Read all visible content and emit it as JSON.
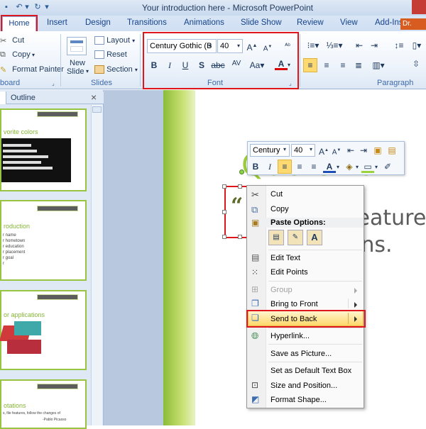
{
  "window": {
    "title": "Your introduction here - Microsoft PowerPoint",
    "user_tab": "Dr."
  },
  "tabs": [
    "Home",
    "Insert",
    "Design",
    "Transitions",
    "Animations",
    "Slide Show",
    "Review",
    "View",
    "Add-Ins"
  ],
  "clipboard": {
    "cut": "Cut",
    "copy": "Copy",
    "format_painter": "Format Painter",
    "label": "board"
  },
  "slides_group": {
    "new_slide_1": "New",
    "new_slide_2": "Slide",
    "layout": "Layout",
    "reset": "Reset",
    "section": "Section",
    "label": "Slides"
  },
  "font_group": {
    "font_name": "Century Gothic (B",
    "font_size": "40",
    "label": "Font"
  },
  "paragraph_group": {
    "label": "Paragraph"
  },
  "pane": {
    "tab_outline": "Outline",
    "close": "×"
  },
  "thumbnails": [
    {
      "title": "vorite colors"
    },
    {
      "title": "roduction",
      "lines": [
        "r name",
        "r hometown",
        "r education",
        "r placement",
        "r goal",
        "r"
      ]
    },
    {
      "title": "or applications"
    },
    {
      "title": "otations",
      "quote": "s, file features, follow the changes of",
      "attrib": "-Pablo Picasso"
    }
  ],
  "slide": {
    "line1": "Quotatio",
    "line2": "features",
    "line3": "ons.",
    "quote_mark": "“"
  },
  "mini_toolbar": {
    "font_name": "Century",
    "font_size": "40"
  },
  "context_menu": {
    "items": [
      {
        "label": "Cut",
        "icon": "scissors-icon",
        "disabled": false
      },
      {
        "label": "Copy",
        "icon": "copy-icon",
        "disabled": false
      },
      {
        "label": "Paste Options:",
        "icon": "paste-icon",
        "header": true
      },
      {
        "label": "Edit Text",
        "icon": "edit-text-icon",
        "disabled": false
      },
      {
        "label": "Edit Points",
        "icon": "edit-points-icon",
        "disabled": false
      },
      {
        "label": "Group",
        "icon": "group-icon",
        "disabled": true,
        "submenu": true
      },
      {
        "label": "Bring to Front",
        "icon": "bring-front-icon",
        "disabled": false,
        "submenu": true
      },
      {
        "label": "Send to Back",
        "icon": "send-back-icon",
        "disabled": false,
        "submenu": true,
        "highlighted": true
      },
      {
        "label": "Hyperlink...",
        "icon": "hyperlink-icon",
        "disabled": false
      },
      {
        "label": "Save as Picture...",
        "disabled": false
      },
      {
        "label": "Set as Default Text Box",
        "disabled": false
      },
      {
        "label": "Size and Position...",
        "icon": "size-position-icon",
        "disabled": false
      },
      {
        "label": "Format Shape...",
        "icon": "format-shape-icon",
        "disabled": false
      }
    ]
  },
  "colors": {
    "accent_red": "#e0161d",
    "slide_green": "#8cbc38"
  }
}
